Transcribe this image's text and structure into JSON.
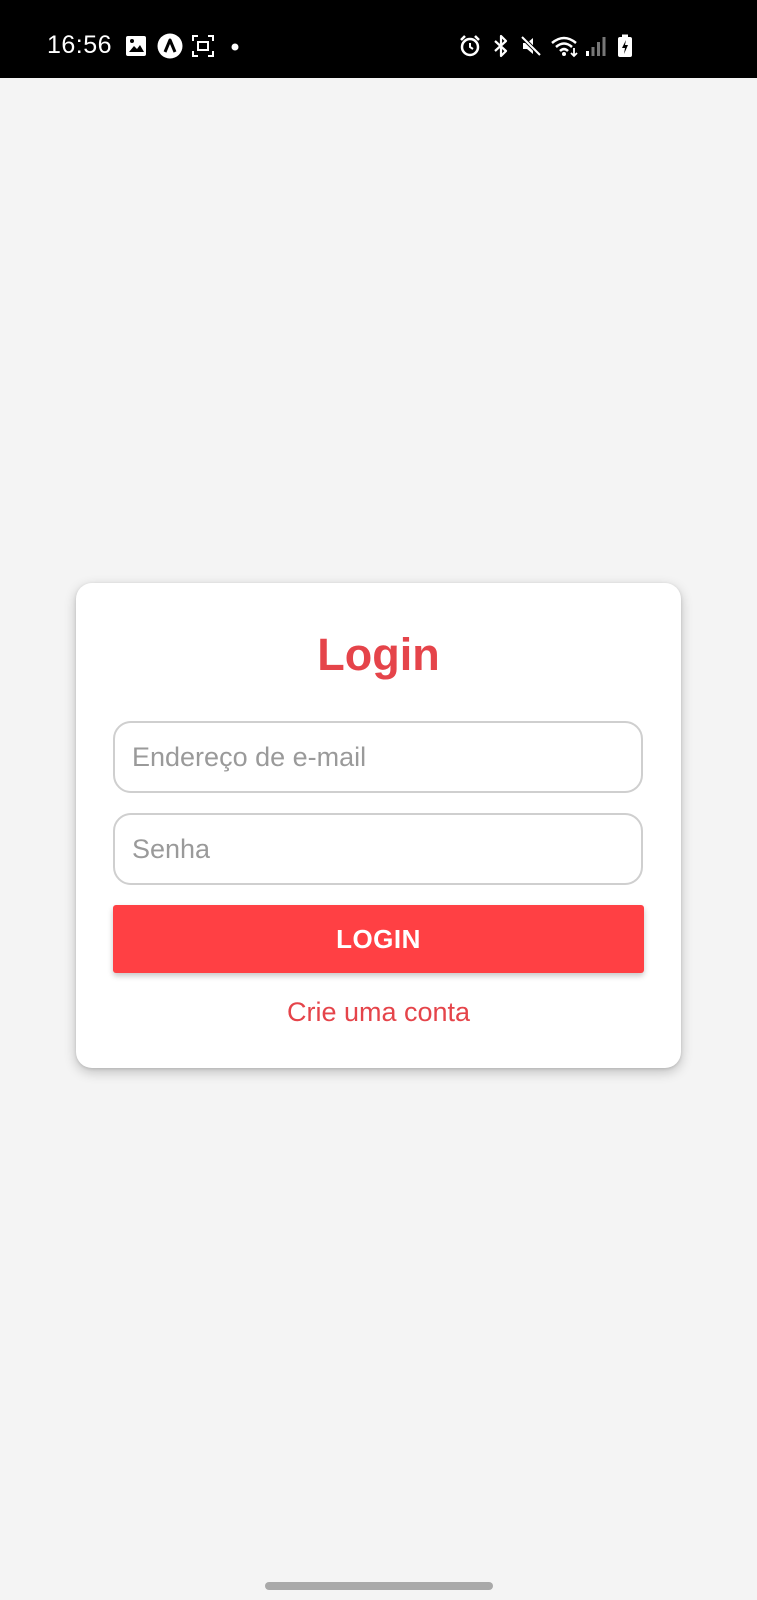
{
  "status_bar": {
    "time": "16:56",
    "left_icons": [
      "image-icon",
      "app-a-icon",
      "screenshot-icon",
      "dot-icon"
    ],
    "right_icons": [
      "alarm-icon",
      "bluetooth-icon",
      "mute-icon",
      "wifi-icon",
      "signal-icon",
      "battery-charging-icon"
    ]
  },
  "login_card": {
    "title": "Login",
    "email_placeholder": "Endereço de e-mail",
    "password_placeholder": "Senha",
    "login_button_label": "LOGIN",
    "create_account_link": "Crie uma conta"
  },
  "colors": {
    "accent": "#e5444a",
    "button_bg": "#ff4044",
    "background": "#f4f4f4",
    "status_bar": "#000000"
  }
}
